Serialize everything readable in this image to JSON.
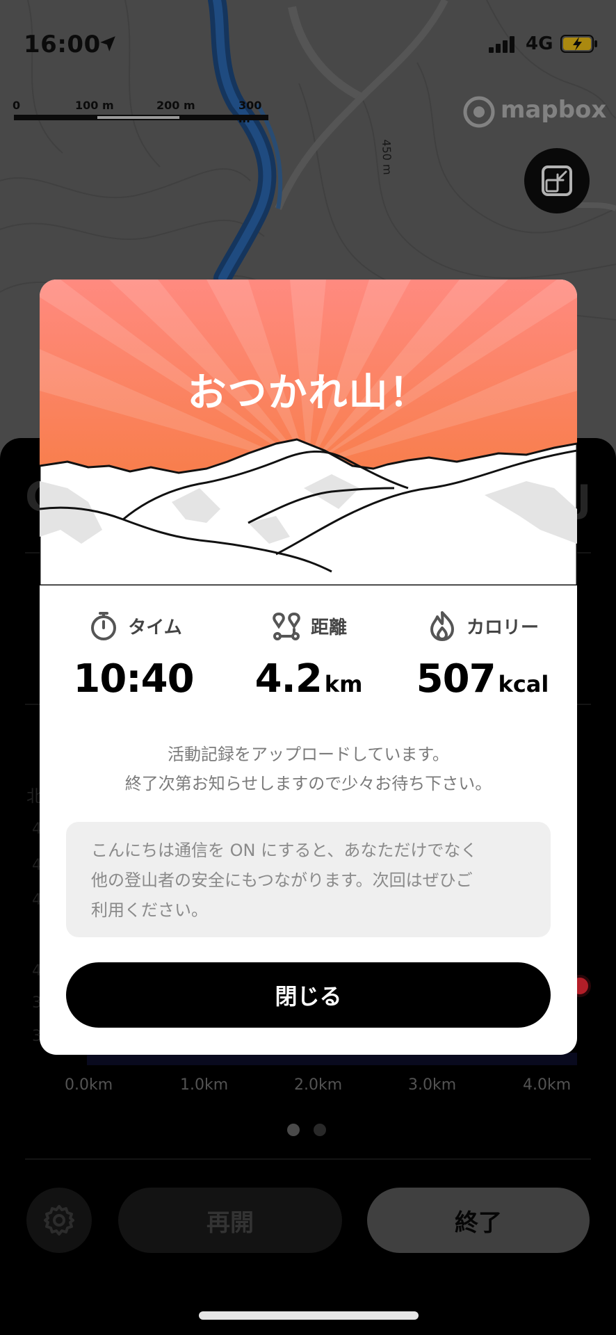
{
  "status_bar": {
    "time": "16:00",
    "network": "4G",
    "location_icon": "location-arrow-icon",
    "battery_icon": "battery-charging-icon"
  },
  "map": {
    "scale_labels": [
      "0",
      "100 m",
      "200 m",
      "300 m"
    ],
    "attribution": "mapbox",
    "contour_label": "450 m",
    "toggle_icon": "map-collapse-icon"
  },
  "modal": {
    "title": "おつかれ山！",
    "stats": [
      {
        "icon": "stopwatch-icon",
        "label": "タイム",
        "value": "10:40",
        "unit": ""
      },
      {
        "icon": "route-icon",
        "label": "距離",
        "value": "4.2",
        "unit": "km"
      },
      {
        "icon": "flame-icon",
        "label": "カロリー",
        "value": "507",
        "unit": "kcal"
      }
    ],
    "upload_message_line1": "活動記録をアップロードしています。",
    "upload_message_line2": "終了次第お知らせしますので少々お待ち下さい。",
    "info_line1": "こんにちは通信を ON にすると、あなただけでなく",
    "info_line2": "他の登山者の安全にもつながります。次回はぜひご",
    "info_line3": "利用ください。",
    "close_label": "閉じる",
    "hero_colors": {
      "top": "#ff8a80",
      "bottom": "#f4772e"
    }
  },
  "sheet": {
    "x_ticks": [
      "0.0km",
      "1.0km",
      "2.0km",
      "3.0km",
      "4.0km"
    ],
    "resume_label": "再開",
    "finish_label": "終了",
    "settings_icon": "gear-icon",
    "page_indicator": {
      "current": 1,
      "total": 2
    }
  }
}
